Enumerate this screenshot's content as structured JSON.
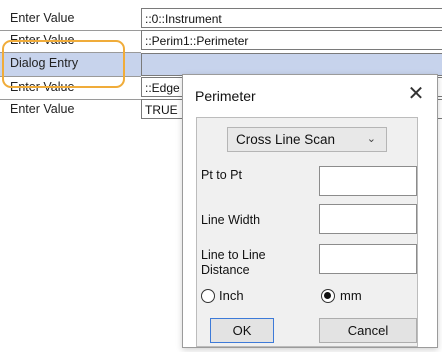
{
  "table": {
    "rows": [
      {
        "label": "Enter Value",
        "value": "::0::Instrument"
      },
      {
        "label": "Enter Value",
        "value": "::Perim1::Perimeter"
      },
      {
        "label": "Dialog Entry",
        "value": ""
      },
      {
        "label": "Enter Value",
        "value": "::Edge"
      },
      {
        "label": "Enter Value",
        "value": "TRUE"
      }
    ]
  },
  "dialog": {
    "title": "Perimeter",
    "close_glyph": "✕",
    "scan_type": "Cross Line Scan",
    "fields": [
      {
        "label": "Pt to Pt",
        "value": ""
      },
      {
        "label": "Line Width",
        "value": ""
      },
      {
        "label": "Line to Line Distance",
        "value": ""
      }
    ],
    "units": {
      "inch_label": "Inch",
      "mm_label": "mm",
      "selected": "mm"
    },
    "ok_label": "OK",
    "cancel_label": "Cancel"
  },
  "colors": {
    "highlight": "#c7d3ec",
    "focus_ring": "#f0ac3a",
    "ok_border": "#3d7ad8"
  }
}
